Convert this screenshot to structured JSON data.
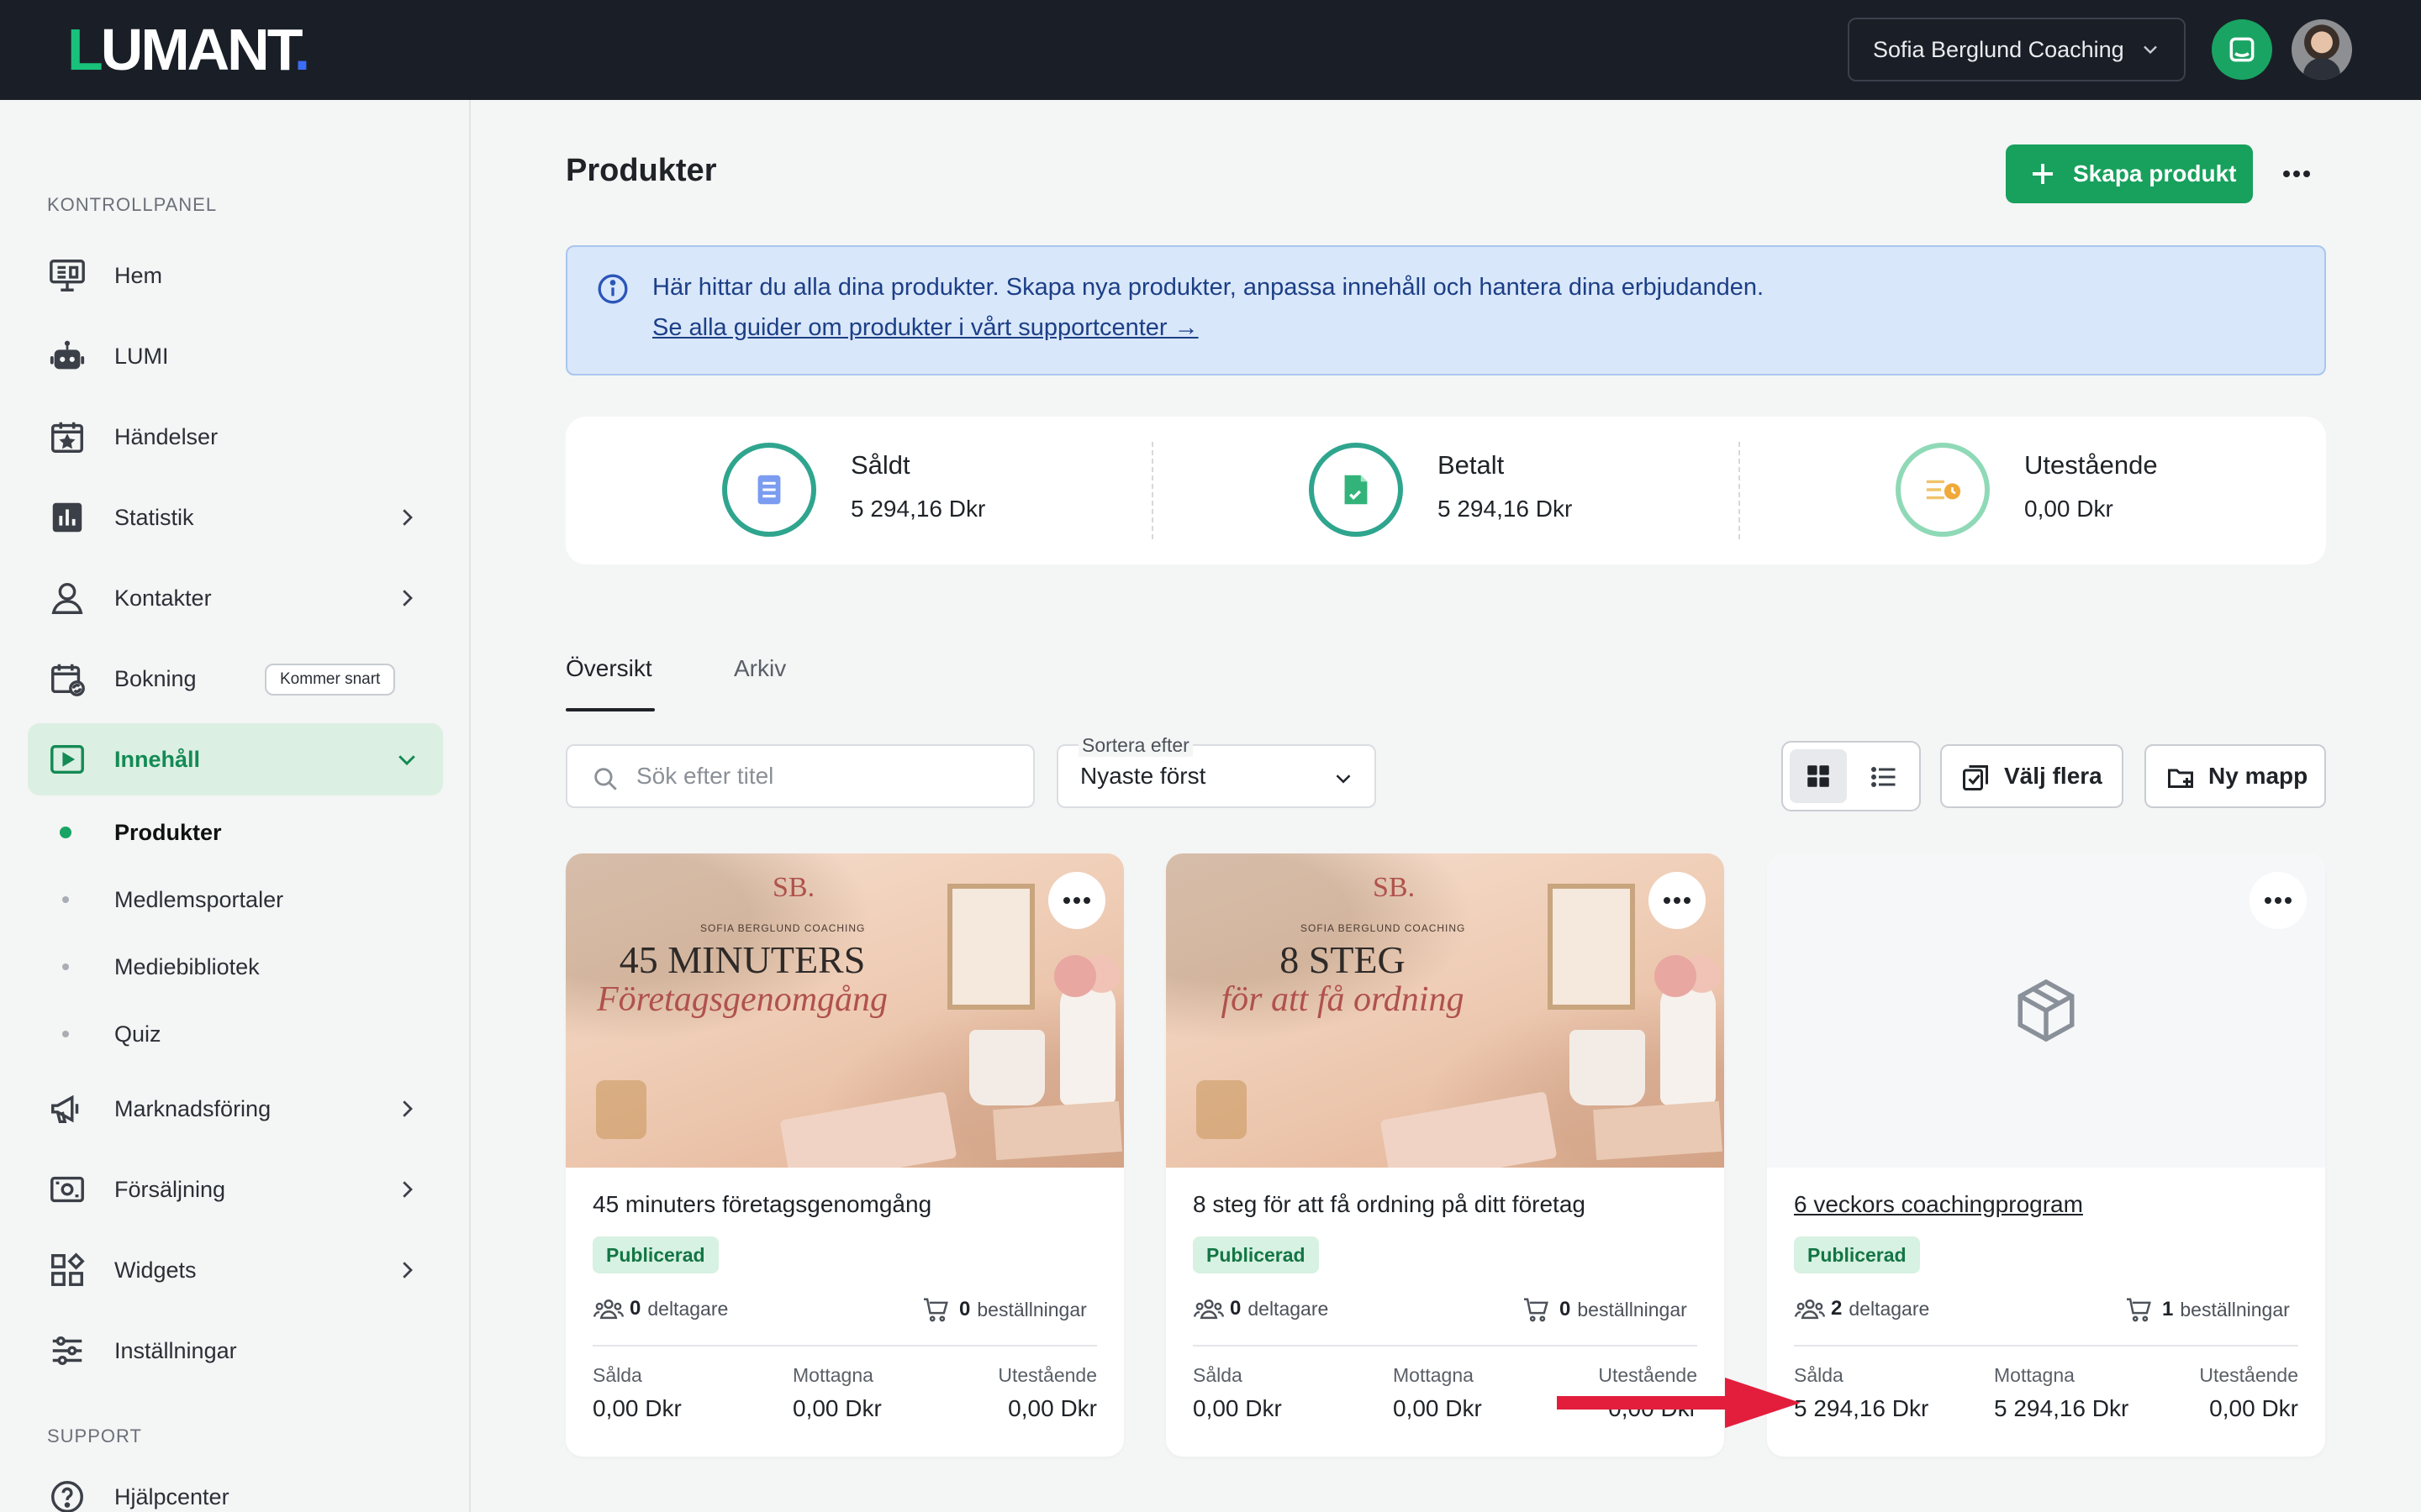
{
  "header": {
    "logo": {
      "l": "L",
      "rest": "UMANT",
      "dot": "."
    },
    "organization": "Sofia Berglund Coaching"
  },
  "sidebar": {
    "section_control": "KONTROLLPANEL",
    "section_support": "SUPPORT",
    "items": [
      {
        "label": "Hem",
        "icon": "monitor-icon"
      },
      {
        "label": "LUMI",
        "icon": "robot-icon"
      },
      {
        "label": "Händelser",
        "icon": "calendar-star-icon"
      },
      {
        "label": "Statistik",
        "icon": "bar-chart-icon",
        "expandable": true
      },
      {
        "label": "Kontakter",
        "icon": "user-icon",
        "expandable": true
      },
      {
        "label": "Bokning",
        "icon": "calendar-refresh-icon",
        "badge": "Kommer snart"
      },
      {
        "label": "Innehåll",
        "icon": "play-icon",
        "active": true
      },
      {
        "label": "Marknadsföring",
        "icon": "megaphone-icon",
        "expandable": true
      },
      {
        "label": "Försäljning",
        "icon": "cash-icon",
        "expandable": true
      },
      {
        "label": "Widgets",
        "icon": "widgets-icon",
        "expandable": true
      },
      {
        "label": "Inställningar",
        "icon": "sliders-icon"
      },
      {
        "label": "Hjälpcenter",
        "icon": "help-icon"
      }
    ],
    "subitems": [
      {
        "label": "Produkter",
        "current": true
      },
      {
        "label": "Medlemsportaler"
      },
      {
        "label": "Mediebibliotek"
      },
      {
        "label": "Quiz"
      }
    ]
  },
  "main": {
    "title": "Produkter",
    "create_button": "Skapa produkt",
    "info": {
      "text": "Här hittar du alla dina produkter. Skapa nya produkter, anpassa innehåll och hantera dina erbjudanden.",
      "link": "Se alla guider om produkter i vårt supportcenter →"
    },
    "stats": [
      {
        "title": "Såldt",
        "value": "5 294,16 Dkr",
        "icon": "receipt-icon"
      },
      {
        "title": "Betalt",
        "value": "5 294,16 Dkr",
        "icon": "paid-document-icon"
      },
      {
        "title": "Utestående",
        "value": "0,00 Dkr",
        "icon": "pending-clock-icon"
      }
    ],
    "tabs": [
      "Översikt",
      "Arkiv"
    ],
    "search_placeholder": "Sök efter titel",
    "sort": {
      "caption": "Sortera efter",
      "value": "Nyaste först"
    },
    "select_multiple": "Välj flera",
    "new_folder": "Ny mapp",
    "colors": {
      "accent": "#18a05d",
      "info_bg": "#d9e7fa",
      "topbar": "#1a1f27"
    }
  },
  "products": [
    {
      "name": "45 minuters företagsgenomgång",
      "status": "Publicerad",
      "participants": "0",
      "participants_label": "deltagare",
      "orders": "0",
      "orders_label": "beställningar",
      "sold_label": "Sålda",
      "sold": "0,00 Dkr",
      "received_label": "Mottagna",
      "received": "0,00 Dkr",
      "outstanding_label": "Utestående",
      "outstanding": "0,00 Dkr",
      "thumb": {
        "sb": "SB.",
        "brand": "SOFIA BERGLUND COACHING",
        "big": "45 MINUTERS",
        "script": "Företagsgenomgång"
      }
    },
    {
      "name": "8 steg för att få ordning på ditt företag",
      "status": "Publicerad",
      "participants": "0",
      "participants_label": "deltagare",
      "orders": "0",
      "orders_label": "beställningar",
      "sold_label": "Sålda",
      "sold": "0,00 Dkr",
      "received_label": "Mottagna",
      "received": "0,00 Dkr",
      "outstanding_label": "Utestående",
      "outstanding": "0,00 Dkr",
      "thumb": {
        "sb": "SB.",
        "brand": "SOFIA BERGLUND COACHING",
        "big": "8 STEG",
        "script": "för att få ordning"
      }
    },
    {
      "name": "6 veckors coachingprogram",
      "status": "Publicerad",
      "participants": "2",
      "participants_label": "deltagare",
      "orders": "1",
      "orders_label": "beställningar",
      "sold_label": "Sålda",
      "sold": "5 294,16 Dkr",
      "received_label": "Mottagna",
      "received": "5 294,16 Dkr",
      "outstanding_label": "Utestående",
      "outstanding": "0,00 Dkr"
    }
  ]
}
